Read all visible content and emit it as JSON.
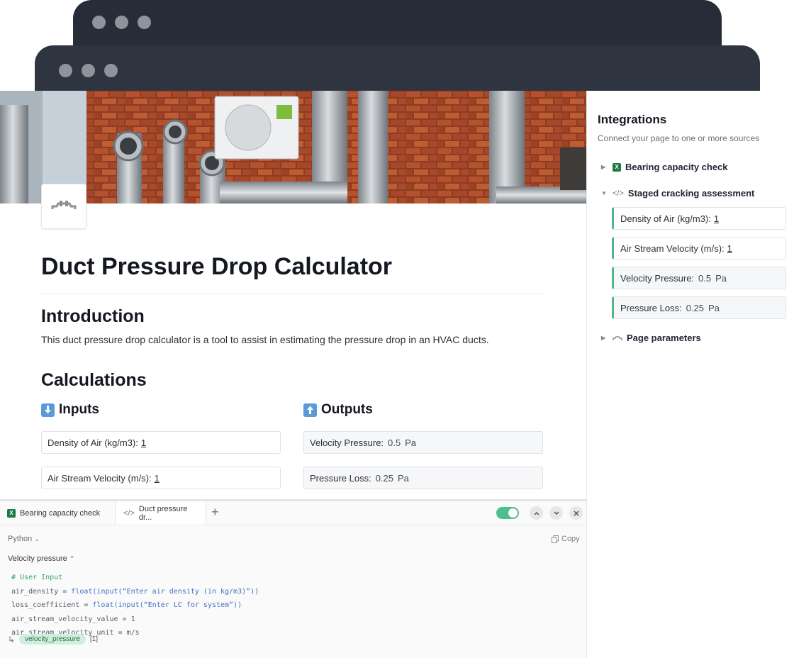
{
  "main": {
    "title": "Duct Pressure Drop Calculator",
    "intro_heading": "Introduction",
    "intro_text": "This duct pressure drop calculator is a tool to assist in estimating the pressure drop in an HVAC ducts.",
    "calc_heading": "Calculations",
    "inputs_heading": "Inputs",
    "outputs_heading": "Outputs",
    "inputs": [
      {
        "label": "Density of Air (kg/m3):",
        "value": "1"
      },
      {
        "label": "Air Stream Velocity (m/s):",
        "value": "1"
      }
    ],
    "outputs": [
      {
        "label": "Velocity Pressure:",
        "value": "0.5",
        "unit": "Pa"
      },
      {
        "label": "Pressure Loss:",
        "value": "0.25",
        "unit": "Pa"
      }
    ]
  },
  "code_panel": {
    "tabs": [
      {
        "label": "Bearing capacity check",
        "icon": "excel-icon"
      },
      {
        "label": "Duct pressure dr...",
        "icon": "code-icon"
      }
    ],
    "language": "Python",
    "copy_label": "Copy",
    "section": "Velocity pressure",
    "code_lines": {
      "l1": "# User Input",
      "l2a": "air_density = ",
      "l2b": "float(input(“Enter air density (in kg/m3)”))",
      "l3a": "loss_coefficient = ",
      "l3b": "float(input(“Enter LC for system”))",
      "l4": "air_stream_velocity_value = 1",
      "l5": "air_stream_velocity_unit = m/s"
    },
    "result_name": "velocity_pressure",
    "result_value": "[1]",
    "toggle_on": true
  },
  "sidebar": {
    "title": "Integrations",
    "subtitle": "Connect your page to one or more sources",
    "sources": [
      {
        "label": "Bearing capacity check",
        "expanded": false
      },
      {
        "label": "Staged cracking assessment",
        "expanded": true
      },
      {
        "label": "Page parameters",
        "expanded": false
      }
    ],
    "fields": [
      {
        "label": "Density of Air (kg/m3):",
        "value": "1"
      },
      {
        "label": "Air Stream Velocity (m/s):",
        "value": "1"
      },
      {
        "label": "Velocity Pressure:",
        "value": "0.5",
        "unit": "Pa"
      },
      {
        "label": "Pressure Loss:",
        "value": "0.25",
        "unit": "Pa"
      }
    ]
  },
  "colors": {
    "window_chrome": "#2e3440",
    "accent_green": "#52b788",
    "toggle_green": "#4bbf8d"
  }
}
